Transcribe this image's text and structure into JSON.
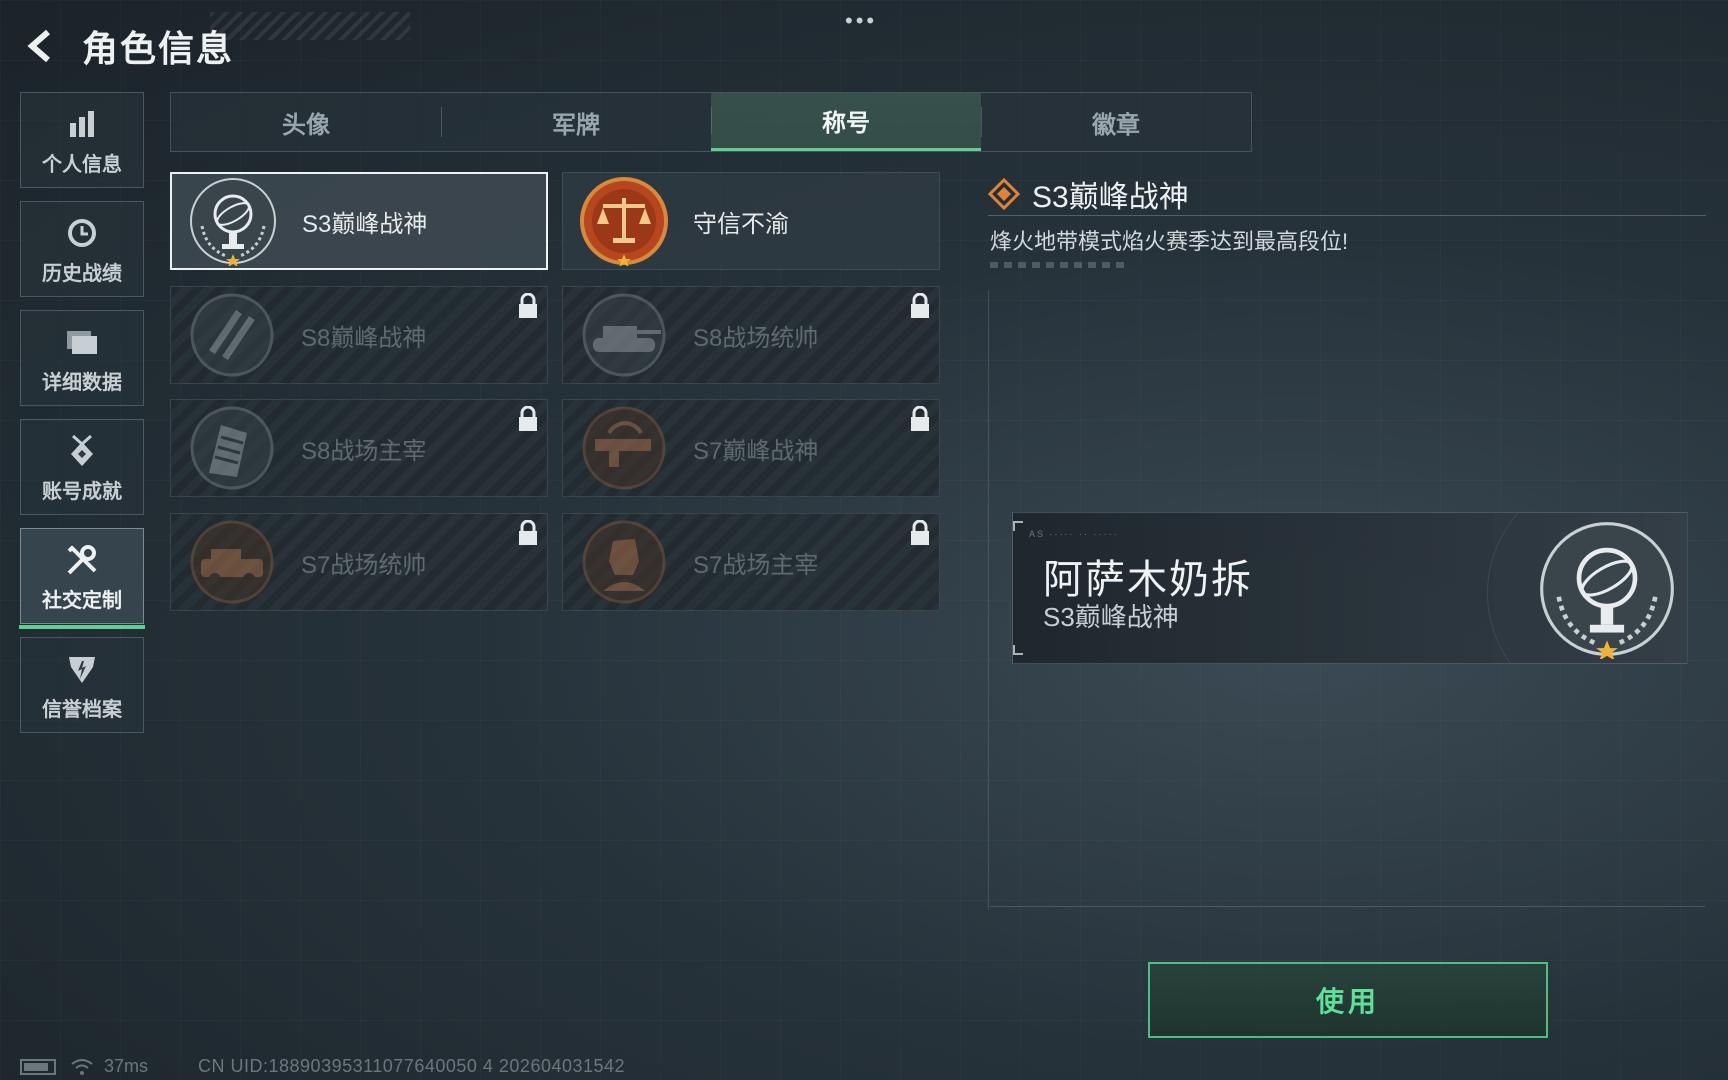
{
  "header": {
    "title": "角色信息",
    "back_icon": "back-arrow-icon",
    "menu_dots": "•••"
  },
  "sidebar": {
    "items": [
      {
        "label": "个人信息",
        "icon": "bar-chart-icon",
        "active": false
      },
      {
        "label": "历史战绩",
        "icon": "clock-history-icon",
        "active": false
      },
      {
        "label": "详细数据",
        "icon": "folder-icon",
        "active": false
      },
      {
        "label": "账号成就",
        "icon": "medal-icon",
        "active": false
      },
      {
        "label": "社交定制",
        "icon": "tools-icon",
        "active": true
      },
      {
        "label": "信誉档案",
        "icon": "credit-badge-icon",
        "active": false
      }
    ]
  },
  "tabs": [
    {
      "label": "头像",
      "active": false
    },
    {
      "label": "军牌",
      "active": false
    },
    {
      "label": "称号",
      "active": true
    },
    {
      "label": "徽章",
      "active": false
    }
  ],
  "titles": [
    {
      "label": "S3巅峰战神",
      "emblem": "armillary-sphere-emblem",
      "locked": false,
      "selected": true
    },
    {
      "label": "守信不渝",
      "emblem": "scales-emblem",
      "locked": false,
      "selected": false
    },
    {
      "label": "S8巅峰战神",
      "emblem": "slash-emblem",
      "locked": true,
      "selected": false
    },
    {
      "label": "S8战场统帅",
      "emblem": "tank-emblem",
      "locked": true,
      "selected": false
    },
    {
      "label": "S8战场主宰",
      "emblem": "building-emblem",
      "locked": true,
      "selected": false
    },
    {
      "label": "S7巅峰战神",
      "emblem": "gun-emblem",
      "locked": true,
      "selected": false
    },
    {
      "label": "S7战场统帅",
      "emblem": "vehicle-emblem",
      "locked": true,
      "selected": false
    },
    {
      "label": "S7战场主宰",
      "emblem": "soldier-emblem",
      "locked": true,
      "selected": false
    }
  ],
  "detail": {
    "title": "S3巅峰战神",
    "description": "烽火地带模式焰火赛季达到最高段位!",
    "title_icon": "diamond-icon",
    "accent": "#e0823a"
  },
  "preview": {
    "name": "阿萨木奶拆",
    "title": "S3巅峰战神",
    "small_text": "AS ····· ·· ·····"
  },
  "actions": {
    "use_label": "使用"
  },
  "status_bar": {
    "ping": "37ms",
    "uid": "CN UID:18890395311077640050 4 202604031542"
  },
  "colors": {
    "active_green": "#5fd08f",
    "button_text": "#5fe09a",
    "emblem_orange": "#b5461e"
  }
}
